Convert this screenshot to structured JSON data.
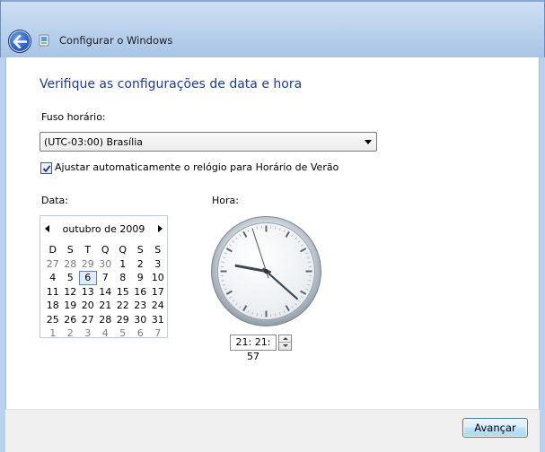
{
  "window": {
    "title": "Configurar o Windows"
  },
  "page": {
    "heading": "Verifique as configurações de data e hora"
  },
  "timezone": {
    "label": "Fuso horário:",
    "selected": "(UTC-03:00) Brasília"
  },
  "dst": {
    "label": "Ajustar automaticamente o relógio para Horário de Verão",
    "checked": true
  },
  "date": {
    "label": "Data:",
    "month_title": "outubro de 2009",
    "weekdays": [
      "D",
      "S",
      "T",
      "Q",
      "Q",
      "S",
      "S"
    ],
    "selected_day": "6",
    "weeks": [
      [
        {
          "d": "27",
          "m": true
        },
        {
          "d": "28",
          "m": true
        },
        {
          "d": "29",
          "m": true
        },
        {
          "d": "30",
          "m": true
        },
        {
          "d": "1"
        },
        {
          "d": "2"
        },
        {
          "d": "3"
        }
      ],
      [
        {
          "d": "4"
        },
        {
          "d": "5"
        },
        {
          "d": "6"
        },
        {
          "d": "7"
        },
        {
          "d": "8"
        },
        {
          "d": "9"
        },
        {
          "d": "10"
        }
      ],
      [
        {
          "d": "11"
        },
        {
          "d": "12"
        },
        {
          "d": "13"
        },
        {
          "d": "14"
        },
        {
          "d": "15"
        },
        {
          "d": "16"
        },
        {
          "d": "17"
        }
      ],
      [
        {
          "d": "18"
        },
        {
          "d": "19"
        },
        {
          "d": "20"
        },
        {
          "d": "21"
        },
        {
          "d": "22"
        },
        {
          "d": "23"
        },
        {
          "d": "24"
        }
      ],
      [
        {
          "d": "25"
        },
        {
          "d": "26"
        },
        {
          "d": "27"
        },
        {
          "d": "28"
        },
        {
          "d": "29"
        },
        {
          "d": "30"
        },
        {
          "d": "31"
        }
      ],
      [
        {
          "d": "1",
          "m": true
        },
        {
          "d": "2",
          "m": true
        },
        {
          "d": "3",
          "m": true
        },
        {
          "d": "4",
          "m": true
        },
        {
          "d": "5",
          "m": true
        },
        {
          "d": "6",
          "m": true
        },
        {
          "d": "7",
          "m": true
        }
      ]
    ]
  },
  "time": {
    "label": "Hora:",
    "value": "21: 21: 57",
    "hours": 21,
    "minutes": 21,
    "seconds": 57
  },
  "footer": {
    "next_label": "Avançar"
  },
  "colors": {
    "heading": "#1e3e8a",
    "accent": "#2d63c8"
  },
  "icons": {
    "back": "back-arrow-icon",
    "wizard": "setup-wizard-icon"
  }
}
